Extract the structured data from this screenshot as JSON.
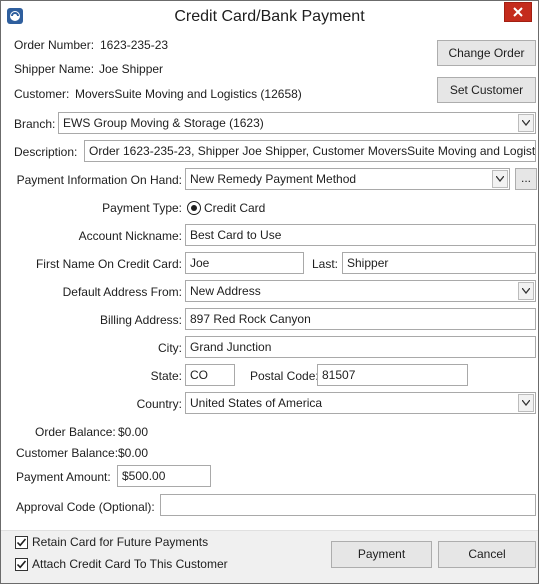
{
  "window": {
    "title": "Credit Card/Bank Payment"
  },
  "order": {
    "number_label": "Order Number:",
    "number_value": "1623-235-23",
    "shipper_label": "Shipper Name:",
    "shipper_value": "Joe Shipper",
    "customer_label": "Customer:",
    "customer_value": "MoversSuite Moving and Logistics (12658)"
  },
  "buttons": {
    "change_order": "Change Order",
    "set_customer": "Set Customer",
    "browse": "...",
    "payment": "Payment",
    "cancel": "Cancel"
  },
  "form": {
    "branch_label": "Branch:",
    "branch_value": "EWS Group Moving & Storage (1623)",
    "description_label": "Description:",
    "description_value": "Order 1623-235-23, Shipper Joe Shipper, Customer MoversSuite Moving and Logistic",
    "payment_info_label": "Payment Information On Hand:",
    "payment_info_value": "New Remedy Payment Method",
    "payment_type_label": "Payment Type:",
    "payment_type_value": "Credit Card",
    "nickname_label": "Account Nickname:",
    "nickname_value": "Best Card to Use",
    "first_name_label": "First Name On Credit Card:",
    "first_name_value": "Joe",
    "last_label": "Last:",
    "last_value": "Shipper",
    "default_address_label": "Default Address From:",
    "default_address_value": "New Address",
    "billing_label": "Billing Address:",
    "billing_value": "897 Red Rock Canyon",
    "city_label": "City:",
    "city_value": "Grand Junction",
    "state_label": "State:",
    "state_value": "CO",
    "postal_label": "Postal Code:",
    "postal_value": "81507",
    "country_label": "Country:",
    "country_value": "United States of America",
    "order_balance_label": "Order Balance:",
    "order_balance_value": "$0.00",
    "customer_balance_label": "Customer Balance:",
    "customer_balance_value": "$0.00",
    "payment_amount_label": "Payment Amount:",
    "payment_amount_value": "$500.00",
    "approval_label": "Approval Code (Optional):",
    "approval_value": ""
  },
  "options": {
    "retain_card_label": "Retain Card for Future Payments",
    "retain_card_checked": true,
    "attach_card_label": "Attach Credit Card To This Customer",
    "attach_card_checked": true
  },
  "icons": {
    "app": "app-icon",
    "close": "close-icon",
    "dropdown": "chevron-down-icon",
    "check": "checkmark-icon"
  }
}
